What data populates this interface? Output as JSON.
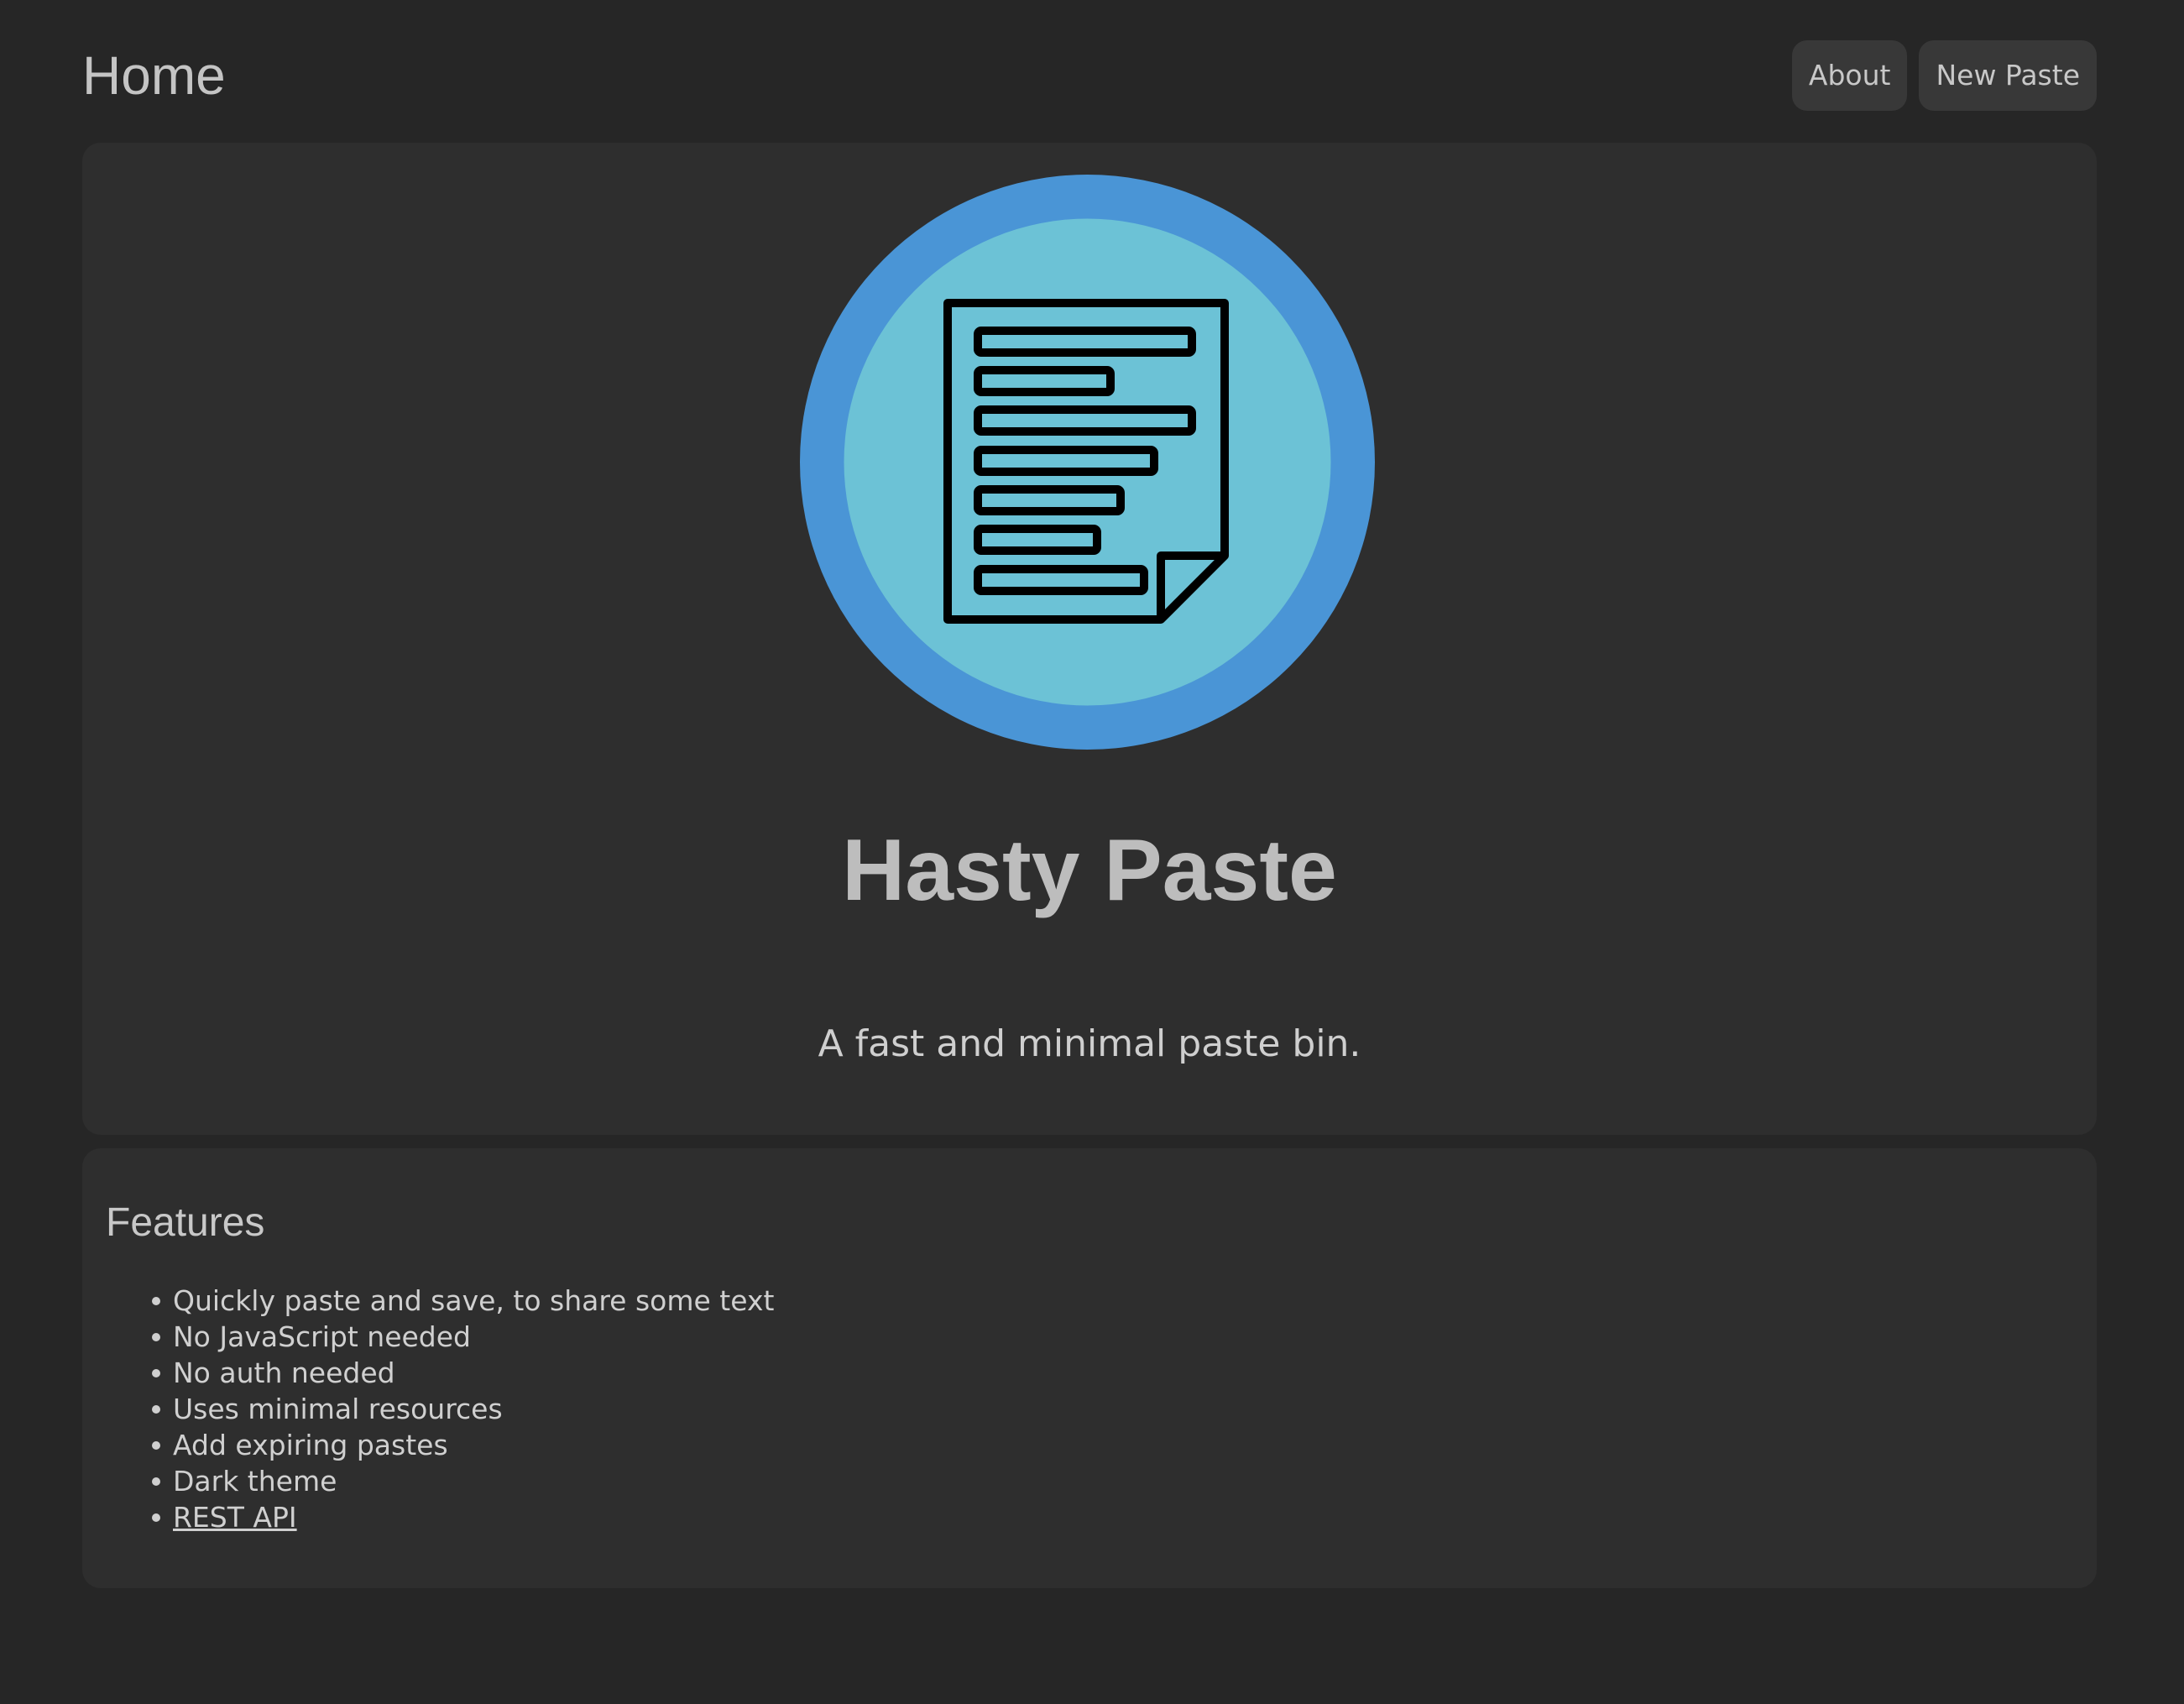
{
  "header": {
    "title": "Home",
    "nav": {
      "about_label": "About",
      "new_paste_label": "New Paste"
    }
  },
  "hero": {
    "title": "Hasty Paste",
    "subtitle": "A fast and minimal paste bin.",
    "logo_icon": "document-icon",
    "colors": {
      "logo_outer": "#4a95d6",
      "logo_inner": "#6cc2d6",
      "logo_stroke": "#000000"
    }
  },
  "features": {
    "title": "Features",
    "items": [
      "Quickly paste and save, to share some text",
      "No JavaScript needed",
      "No auth needed",
      "Uses minimal resources",
      "Add expiring pastes",
      "Dark theme"
    ],
    "api_link_label": "REST API"
  }
}
